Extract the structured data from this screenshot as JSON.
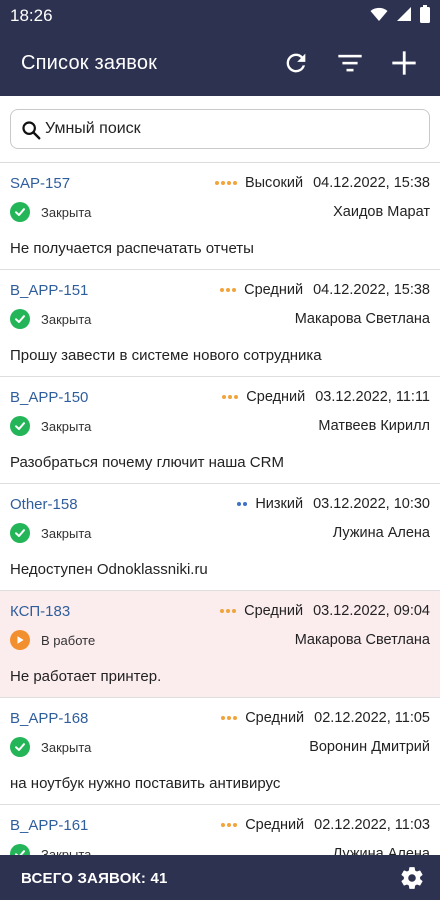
{
  "status_bar": {
    "time": "18:26"
  },
  "header": {
    "title": "Список заявок"
  },
  "search": {
    "placeholder": "Умный поиск"
  },
  "colors": {
    "primary": "#2e3251",
    "link": "#2f5e9c",
    "status_closed": "#23b557",
    "status_in_progress": "#f2902f",
    "priority_high": "#f2a43c",
    "priority_medium": "#f2a43c",
    "priority_low": "#3f70c7",
    "active_row": "#fbecee"
  },
  "tickets": [
    {
      "id": "SAP-157",
      "priority": "Высокий",
      "priority_level": 4,
      "date": "04.12.2022, 15:38",
      "status": "Закрыта",
      "status_type": "closed",
      "assignee": "Хаидов Марат",
      "title": "Не получается распечатать отчеты"
    },
    {
      "id": "B_APP-151",
      "priority": "Средний",
      "priority_level": 3,
      "date": "04.12.2022, 15:38",
      "status": "Закрыта",
      "status_type": "closed",
      "assignee": "Макарова Светлана",
      "title": "Прошу завести в системе нового сотрудника"
    },
    {
      "id": "B_APP-150",
      "priority": "Средний",
      "priority_level": 3,
      "date": "03.12.2022, 11:11",
      "status": "Закрыта",
      "status_type": "closed",
      "assignee": "Матвеев Кирилл",
      "title": "Разобраться почему глючит наша CRM"
    },
    {
      "id": "Other-158",
      "priority": "Низкий",
      "priority_level": 2,
      "date": "03.12.2022, 10:30",
      "status": "Закрыта",
      "status_type": "closed",
      "assignee": "Лужина Алена",
      "title": "Недоступен Odnoklassniki.ru"
    },
    {
      "id": "КСП-183",
      "priority": "Средний",
      "priority_level": 3,
      "date": "03.12.2022, 09:04",
      "status": "В работе",
      "status_type": "in_progress",
      "assignee": "Макарова Светлана",
      "title": "Не работает принтер.",
      "highlighted": true
    },
    {
      "id": "B_APP-168",
      "priority": "Средний",
      "priority_level": 3,
      "date": "02.12.2022, 11:05",
      "status": "Закрыта",
      "status_type": "closed",
      "assignee": "Воронин Дмитрий",
      "title": "на ноутбук нужно поставить антивирус"
    },
    {
      "id": "B_APP-161",
      "priority": "Средний",
      "priority_level": 3,
      "date": "02.12.2022, 11:03",
      "status": "Закрыта",
      "status_type": "closed",
      "assignee": "Лужина Алена",
      "title": ""
    }
  ],
  "footer": {
    "total_label": "ВСЕГО ЗАЯВОК:",
    "total_count": "41"
  }
}
